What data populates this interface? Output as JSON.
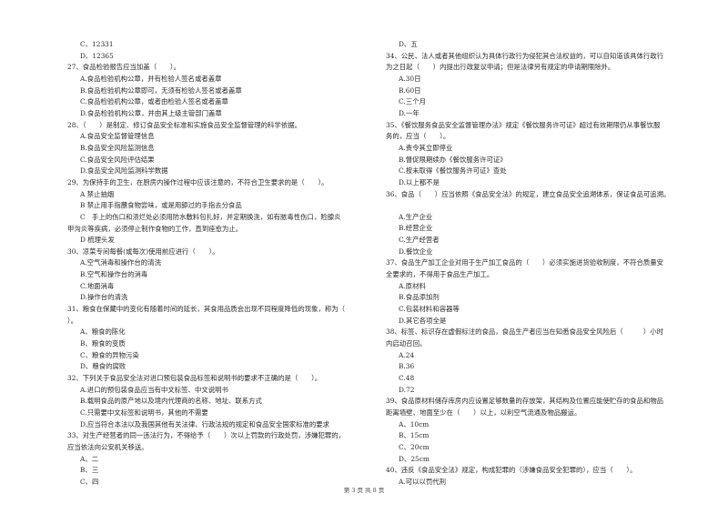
{
  "page": {
    "footer": "第 3 页 共 8 页"
  },
  "left_column": [
    {
      "type": "opt",
      "text": "C、12331"
    },
    {
      "type": "opt",
      "text": "D、12365"
    },
    {
      "type": "q",
      "text": "27、食品检验报告应当加盖（　　）。"
    },
    {
      "type": "opt",
      "text": "A.食品检验机构公章，并有检验人签名或者盖章"
    },
    {
      "type": "opt",
      "text": "B.食品检验机构公章即可，无须有检验人签名或者盖章"
    },
    {
      "type": "opt",
      "text": "C.食品检验机构公章，或者由检验人签名或者盖章"
    },
    {
      "type": "opt",
      "text": "D.食品检验机构公章，并由其上级主管部门盖章"
    },
    {
      "type": "q",
      "text": "28、（　　）是制定、修订食品安全标准和实施食品安全监督管理的科学依据。"
    },
    {
      "type": "opt",
      "text": "A.食品安全监督管理信息"
    },
    {
      "type": "opt",
      "text": "B.食品安全风险监测信息"
    },
    {
      "type": "opt",
      "text": "C.食品安全风险评估结果"
    },
    {
      "type": "opt",
      "text": "D.食品安全风险监测科学数据"
    },
    {
      "type": "q",
      "text": "29、为保持手的卫生，在厨房内操作过程中应该注意的，不符合卫生要求的是（　　）。"
    },
    {
      "type": "opt",
      "text": "A 禁止抽烟"
    },
    {
      "type": "opt",
      "text": "B 禁止用手指蘸食物尝味，或是用舔过的手指去分食品"
    },
    {
      "type": "opt",
      "text": "C　手上的伤口和溃烂处必须用防水敷料包扎好，并定期换洗，如有脓毒性伤口，睑腺炎"
    },
    {
      "type": "cont",
      "text": "甲沟炎等疾病，必须停止制作食物的工作，直到痊愈为止。"
    },
    {
      "type": "opt",
      "text": "D 梳理头发"
    },
    {
      "type": "q",
      "text": "30、凉菜专间每餐(或每次)使用前应进行（　　）。"
    },
    {
      "type": "opt",
      "text": "A.空气消毒和操作台的清洗"
    },
    {
      "type": "opt",
      "text": "B.空气和操作台的消毒"
    },
    {
      "type": "opt",
      "text": "C.地面消毒"
    },
    {
      "type": "opt",
      "text": "D.操作台的清洗"
    },
    {
      "type": "q",
      "text": "31、粮食在保藏中的变化有随着时间的延长，其食用品质会出现不同程度降低的现象，称为（"
    },
    {
      "type": "cont",
      "text": "）。"
    },
    {
      "type": "opt",
      "text": "A、粮食的陈化"
    },
    {
      "type": "opt",
      "text": "B、粮食的变质"
    },
    {
      "type": "opt",
      "text": "C、粮食的异物污染"
    },
    {
      "type": "opt",
      "text": "D、粮食的腐败"
    },
    {
      "type": "q",
      "text": "32、下列关于食品安全法对进口预包装食品标签和说明书的要求不正确的是（　　）。"
    },
    {
      "type": "opt",
      "text": "A.进口的预包装食品应当有中文标签、中文说明书"
    },
    {
      "type": "opt",
      "text": "B.载明食品的原产地以及境内代理商的名称、地址、联系方式"
    },
    {
      "type": "opt",
      "text": "C.只需要中文标签和说明书，其他的不需要"
    },
    {
      "type": "opt",
      "text": "D.应当符合本法以及我国其他有关法律、行政法规的规定和食品安全国家标准的要求"
    },
    {
      "type": "q",
      "text": "33、对生产经营者的同一违法行为，不得给予（　　）次以上罚款的行政处罚，涉嫌犯罪的，"
    },
    {
      "type": "cont",
      "text": "应当依法向公安机关移送。"
    },
    {
      "type": "opt",
      "text": "A、二"
    },
    {
      "type": "opt",
      "text": "B、三"
    },
    {
      "type": "opt",
      "text": "C、四"
    }
  ],
  "right_column": [
    {
      "type": "opt",
      "text": "D、五"
    },
    {
      "type": "q",
      "text": "34、公民、法人或者其他组织认为具体行政行为侵犯其合法权益的，可以自知道该具体行政行"
    },
    {
      "type": "cont",
      "text": "为之日起（　　）内提出行政复议申请；但是法律另有规定的申请期限除外。"
    },
    {
      "type": "opt",
      "text": "A.30日"
    },
    {
      "type": "opt",
      "text": "B.60日"
    },
    {
      "type": "opt",
      "text": "C.三个月"
    },
    {
      "type": "opt",
      "text": "D.一年"
    },
    {
      "type": "q",
      "text": "35、《餐饮服务食品安全监督管理办法》规定《餐饮服务许可证》超过有效期限仍从事餐饮服"
    },
    {
      "type": "cont",
      "text": "务的，应当（　　）。"
    },
    {
      "type": "opt",
      "text": "A.责令其立即停业"
    },
    {
      "type": "opt",
      "text": "B.督促限期续办《餐饮服务许可证》"
    },
    {
      "type": "opt",
      "text": "C.按未取得《餐饮服务许可证》查处"
    },
    {
      "type": "opt",
      "text": "D.以上都不是"
    },
    {
      "type": "q",
      "text": "36、食品（　　）应当依照《食品安全法》的规定，建立食品安全追溯体系，保证食品可追溯。"
    },
    {
      "type": "blank",
      "text": ""
    },
    {
      "type": "opt",
      "text": "A.生产企业"
    },
    {
      "type": "opt",
      "text": "B.经营企业"
    },
    {
      "type": "opt",
      "text": "C.生产经营者"
    },
    {
      "type": "opt",
      "text": "D.餐饮企业"
    },
    {
      "type": "q",
      "text": "37、食品生产加工企业对用于生产加工食品的（　　）必须实施进货验收制度，不符合质量安"
    },
    {
      "type": "cont",
      "text": "全要求的，不得用于食品生产加工。"
    },
    {
      "type": "opt",
      "text": "A.原材料"
    },
    {
      "type": "opt",
      "text": "B.食品添加剂"
    },
    {
      "type": "opt",
      "text": "C.包装材料和容器等"
    },
    {
      "type": "opt",
      "text": "D.其它各项全是"
    },
    {
      "type": "q",
      "text": "38、标签、标识存在虚假标注的食品，食品生产者应当在知悉食品安全风险后（　　　）小时"
    },
    {
      "type": "cont",
      "text": "内启动召回。"
    },
    {
      "type": "opt",
      "text": "A.24"
    },
    {
      "type": "opt",
      "text": "B.36"
    },
    {
      "type": "opt",
      "text": "C.48"
    },
    {
      "type": "opt",
      "text": "D.72"
    },
    {
      "type": "q",
      "text": "39、食品原材料储存库房内应设置足够数量的存放架，其结构及位置应能使贮存的食品和物品"
    },
    {
      "type": "cont",
      "text": "距离墙壁、地面至少在（　　）以上，以利空气流通及物品搬运。"
    },
    {
      "type": "opt",
      "text": "A、10cm"
    },
    {
      "type": "opt",
      "text": "B、15cm"
    },
    {
      "type": "opt",
      "text": "C、20cm"
    },
    {
      "type": "opt",
      "text": "D、25cm"
    },
    {
      "type": "q",
      "text": "40、违反《食品安全法》规定，构成犯罪的（涉嫌食品安全犯罪的），应当（　　）。"
    },
    {
      "type": "opt",
      "text": "A.可以以罚代刑"
    }
  ]
}
